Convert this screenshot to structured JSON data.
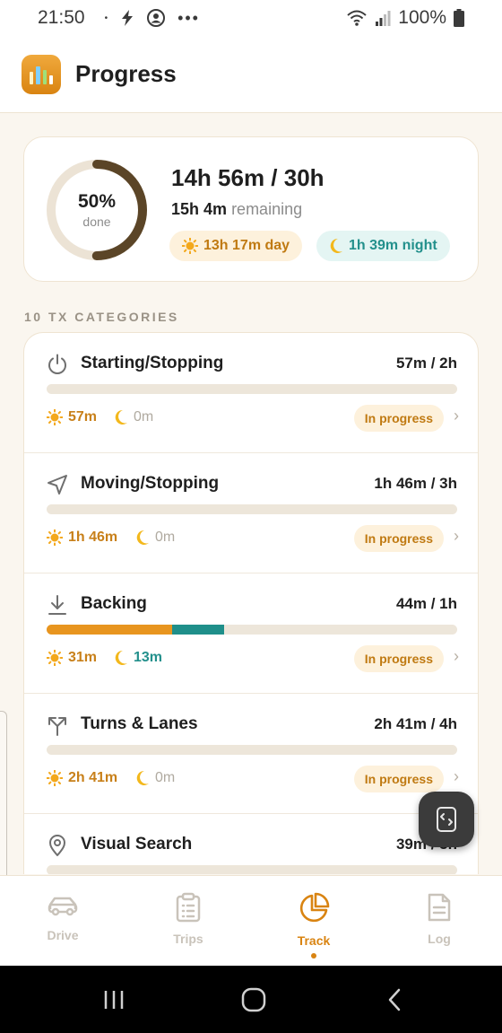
{
  "status_bar": {
    "time": "21:50",
    "battery": "100%"
  },
  "header": {
    "title": "Progress",
    "icon": "bar-chart-app-icon"
  },
  "summary": {
    "percent_label": "50%",
    "percent_value": 0.5,
    "done_label": "done",
    "total": "14h 56m / 30h",
    "remaining_value": "15h 4m",
    "remaining_label": "remaining",
    "day": "13h 17m day",
    "night": "1h 39m night",
    "colors": {
      "ring": "#5b4527",
      "track": "#ece3d5"
    }
  },
  "section_label": "10 TX CATEGORIES",
  "categories": [
    {
      "name": "Starting/Stopping",
      "icon": "power-icon",
      "amount": "57m / 2h",
      "day": "57m",
      "night": "0m",
      "status": "In progress",
      "day_fraction": 0,
      "night_fraction": 0
    },
    {
      "name": "Moving/Stopping",
      "icon": "navigation-arrow-icon",
      "amount": "1h 46m / 3h",
      "day": "1h 46m",
      "night": "0m",
      "status": "In progress",
      "day_fraction": 0,
      "night_fraction": 0
    },
    {
      "name": "Backing",
      "icon": "download-arrow-icon",
      "amount": "44m / 1h",
      "day": "31m",
      "night": "13m",
      "status": "In progress",
      "day_fraction": 0.305,
      "night_fraction": 0.128
    },
    {
      "name": "Turns & Lanes",
      "icon": "split-arrows-icon",
      "amount": "2h 41m / 4h",
      "day": "2h 41m",
      "night": "0m",
      "status": "In progress",
      "day_fraction": 0,
      "night_fraction": 0
    },
    {
      "name": "Visual Search",
      "icon": "map-pin-icon",
      "amount": "39m / 3h",
      "day": "",
      "night": "",
      "status": "",
      "day_fraction": 0,
      "night_fraction": 0
    }
  ],
  "nav": [
    {
      "label": "Drive",
      "icon": "car-icon",
      "active": false
    },
    {
      "label": "Trips",
      "icon": "clipboard-icon",
      "active": false
    },
    {
      "label": "Track",
      "icon": "pie-chart-icon",
      "active": true
    },
    {
      "label": "Log",
      "icon": "document-icon",
      "active": false
    }
  ]
}
